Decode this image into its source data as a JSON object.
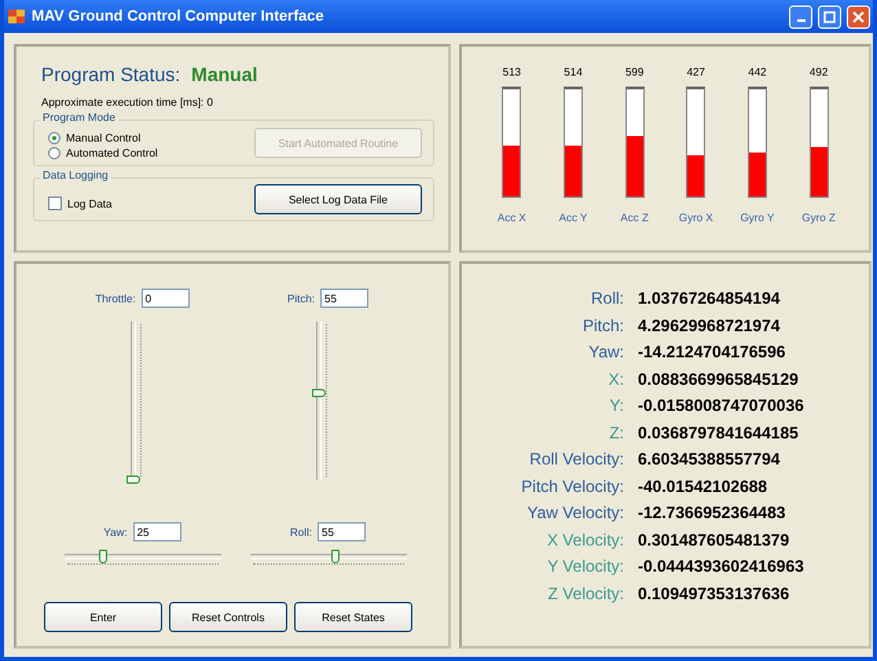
{
  "window": {
    "title": "MAV Ground Control Computer Interface"
  },
  "status": {
    "label": "Program Status:",
    "value": "Manual",
    "execution_time": "Approximate execution time [ms]: 0"
  },
  "program_mode": {
    "title": "Program Mode",
    "options": [
      {
        "label": "Manual Control",
        "selected": true
      },
      {
        "label": "Automated Control",
        "selected": false
      }
    ],
    "button": {
      "label": "Start Automated Routine",
      "disabled": true
    }
  },
  "data_logging": {
    "title": "Data Logging",
    "checkbox": {
      "label": "Log Data",
      "checked": false
    },
    "button": {
      "label": "Select Log Data File",
      "disabled": false
    }
  },
  "sensors": [
    {
      "reading": "513",
      "level": 0.48,
      "label": "Acc X"
    },
    {
      "reading": "514",
      "level": 0.48,
      "label": "Acc Y"
    },
    {
      "reading": "599",
      "level": 0.57,
      "label": "Acc Z"
    },
    {
      "reading": "427",
      "level": 0.39,
      "label": "Gyro X"
    },
    {
      "reading": "442",
      "level": 0.41,
      "label": "Gyro Y"
    },
    {
      "reading": "492",
      "level": 0.46,
      "label": "Gyro Z"
    }
  ],
  "controls": [
    {
      "label": "Throttle:",
      "value": "0",
      "kind": "vertical",
      "level": 0
    },
    {
      "label": "Pitch:",
      "value": "55",
      "kind": "vertical",
      "level": 0.55
    },
    {
      "label": "Yaw:",
      "value": "25",
      "kind": "horizontal",
      "level": 0.25
    },
    {
      "label": "Roll:",
      "value": "55",
      "kind": "horizontal",
      "level": 0.55
    }
  ],
  "buttons": [
    "Enter",
    "Reset Controls",
    "Reset States"
  ],
  "states": [
    {
      "label": "Roll:",
      "value": "1.03767264854194",
      "color": "#2e5e9e"
    },
    {
      "label": "Pitch:",
      "value": "4.29629968721974",
      "color": "#2e5e9e"
    },
    {
      "label": "Yaw:",
      "value": "-14.2124704176596",
      "color": "#2e5e9e"
    },
    {
      "label": "X:",
      "value": "0.0883669965845129",
      "color": "#3a9a90"
    },
    {
      "label": "Y:",
      "value": "-0.0158008747070036",
      "color": "#3a9a90"
    },
    {
      "label": "Z:",
      "value": "0.0368797841644185",
      "color": "#3a9a90"
    },
    {
      "label": "Roll Velocity:",
      "value": "6.60345388557794",
      "color": "#2e5e9e"
    },
    {
      "label": "Pitch Velocity:",
      "value": "-40.01542102688",
      "color": "#2e5e9e"
    },
    {
      "label": "Yaw Velocity:",
      "value": "-12.7366952364483",
      "color": "#2e5e9e"
    },
    {
      "label": "X Velocity:",
      "value": "0.301487605481379",
      "color": "#3a9a90"
    },
    {
      "label": "Y Velocity:",
      "value": "-0.0444393602416963",
      "color": "#3a9a90"
    },
    {
      "label": "Z Velocity:",
      "value": "0.109497353137636",
      "color": "#3a9a90"
    }
  ]
}
